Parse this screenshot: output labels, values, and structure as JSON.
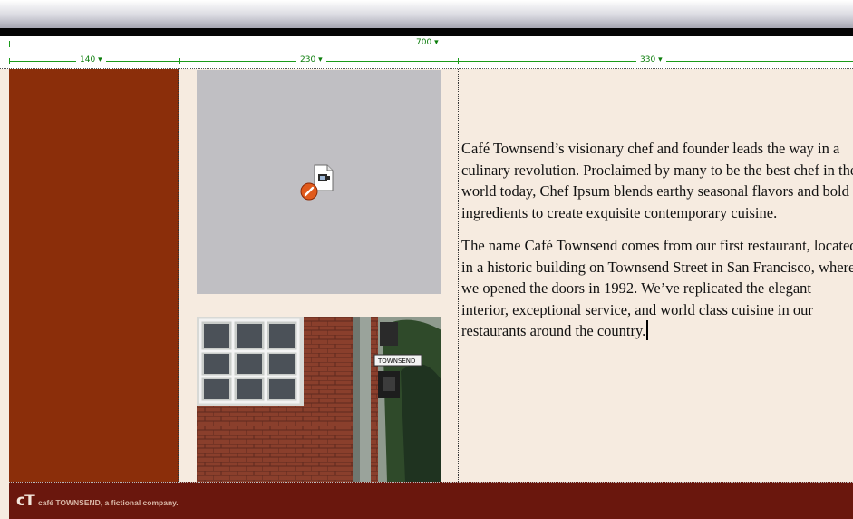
{
  "ruler": {
    "total_width": "700",
    "column_widths": [
      "140",
      "230",
      "330"
    ],
    "dropdown_glyph": "▾"
  },
  "flash_placeholder": {
    "icon": "flash-document-icon",
    "badge_icon": "broken-plugin-icon"
  },
  "photo": {
    "description_icon": "townsend-street-photo",
    "street_sign": "TOWNSEND"
  },
  "content": {
    "paragraphs": [
      "Café Townsend’s visionary chef and founder leads the way in a culinary revolution. Proclaimed by many to be the best chef in the world today, Chef Ipsum blends earthy seasonal flavors and bold ingredients to create exquisite contemporary cuisine.",
      "The name Café Townsend comes from our first restaurant, located in a historic building on Townsend Street in San Francisco, where we opened the doors in 1992. We’ve replicated the elegant interior, exceptional service, and world class cuisine in our restaurants around the country."
    ]
  },
  "footer": {
    "logo": "cT",
    "tagline": "café TOWNSEND, a fictional company."
  },
  "colors": {
    "sidebar": "#8b2e0a",
    "page_background": "#f6ebe0",
    "footer": "#6a170d",
    "ruler_green": "#1a9a1a",
    "flash_placeholder": "#c0bfc3"
  }
}
